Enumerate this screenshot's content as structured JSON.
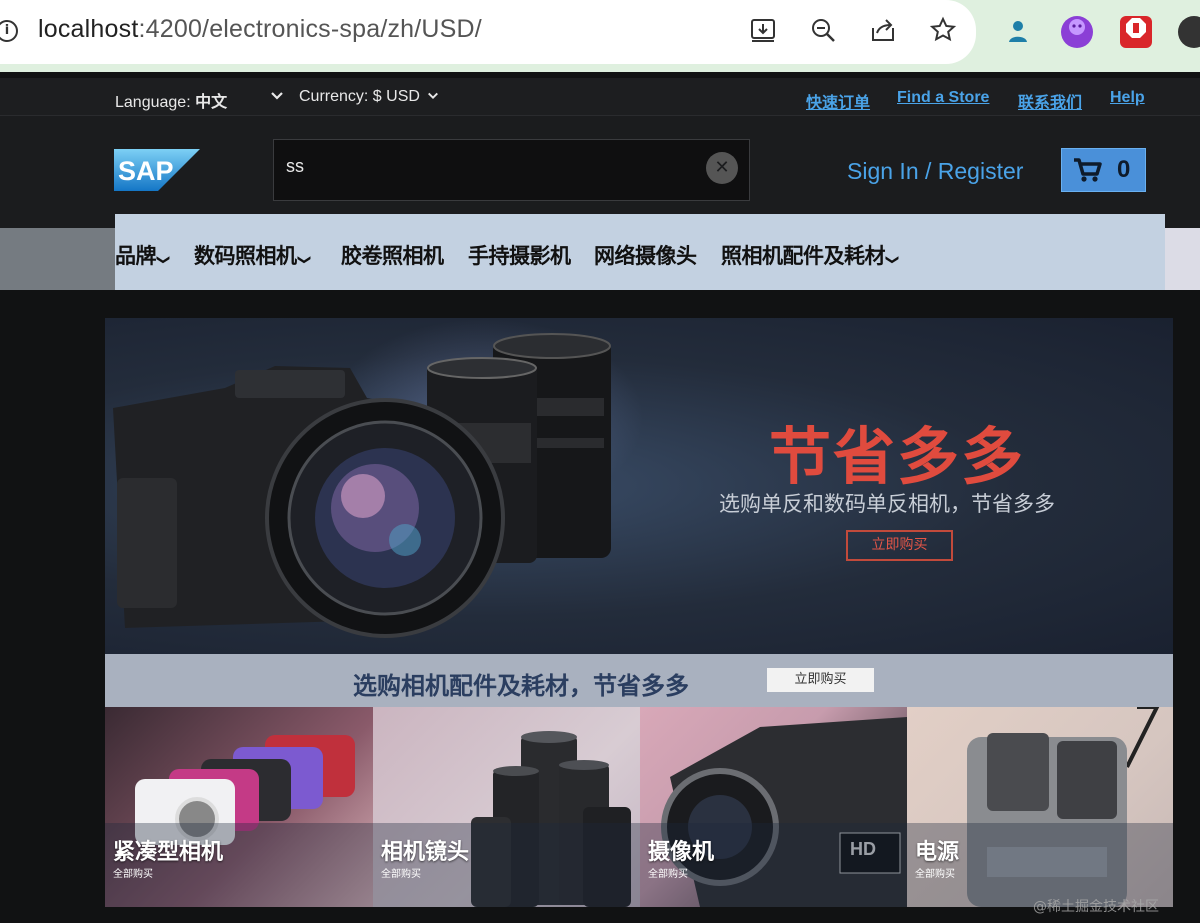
{
  "browser": {
    "url_host": "localhost",
    "url_rest": ":4200/electronics-spa/zh/USD/"
  },
  "utility": {
    "language_label": "Language:",
    "language_value": "中文",
    "currency_label": "Currency: $ USD",
    "links": [
      "快速订单",
      "Find a Store",
      "联系我们",
      "Help"
    ]
  },
  "header": {
    "logo_text": "SAP",
    "search_value": "ss",
    "sign_in": "Sign In / Register",
    "cart_count": "0"
  },
  "nav": {
    "items": [
      {
        "label": "品牌",
        "has_dropdown": true
      },
      {
        "label": "数码照相机",
        "has_dropdown": true
      },
      {
        "label": "胶卷照相机",
        "has_dropdown": false
      },
      {
        "label": "手持摄影机",
        "has_dropdown": false
      },
      {
        "label": "网络摄像头",
        "has_dropdown": false
      },
      {
        "label": "照相机配件及耗材",
        "has_dropdown": true
      }
    ]
  },
  "hero": {
    "title": "节省多多",
    "subtitle": "选购单反和数码单反相机，节省多多",
    "button": "立即购买"
  },
  "promo": {
    "text": "选购相机配件及耗材，节省多多",
    "button": "立即购买"
  },
  "tiles": [
    {
      "label": "紧凑型相机",
      "sub": "全部购买"
    },
    {
      "label": "相机镜头",
      "sub": "全部购买"
    },
    {
      "label": "摄像机",
      "sub": "全部购买"
    },
    {
      "label": "电源",
      "sub": "全部购买"
    }
  ],
  "watermark": "@稀土掘金技术社区",
  "colors": {
    "link_blue": "#4aa3e8",
    "cart_blue": "#4a90d9",
    "hero_red": "#e04b3e",
    "nav_bg": "#c3d1e1"
  }
}
